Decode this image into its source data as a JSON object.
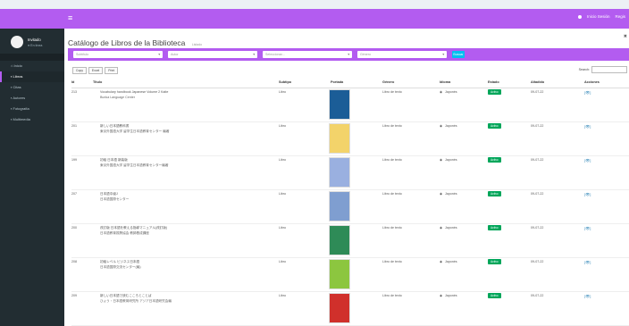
{
  "topbar": {
    "menu_icon": "hamburger-icon",
    "nav_items": [
      "Inicio Sesión",
      "Regis"
    ]
  },
  "sidebar": {
    "user_name": "Invitado",
    "user_status": "● En línea",
    "items": [
      {
        "label": "Inicio",
        "icon": "home-icon"
      },
      {
        "label": "Libros",
        "icon": "book-icon",
        "active": true
      },
      {
        "label": "Citas",
        "icon": "calendar-icon"
      },
      {
        "label": "Autores",
        "icon": "user-icon"
      },
      {
        "label": "Fotografía",
        "icon": "image-icon"
      },
      {
        "label": "Multimedia",
        "icon": "media-icon"
      }
    ]
  },
  "page": {
    "title": "Catálogo de Libros de la Biblioteca",
    "subtitle": "Listado"
  },
  "filters": {
    "fields": [
      {
        "placeholder": "Subtítulo"
      },
      {
        "placeholder": "Autor"
      },
      {
        "placeholder": "Seleccionar..."
      },
      {
        "placeholder": "Género"
      }
    ],
    "search_button": "Buscar"
  },
  "exports": [
    "Copy",
    "Excel",
    "Print"
  ],
  "search": {
    "label": "Search:"
  },
  "table": {
    "headers": [
      "Id",
      "Titulo",
      "Subtipo",
      "Portada",
      "Género",
      "Idioma",
      "Estado",
      "Añadido",
      "Acciones"
    ],
    "rows": [
      {
        "id": "213",
        "title": "Vocabulary handbook Japanese Volume 2 Kaite",
        "author": "Bunka Language Center",
        "subtype": "Libro",
        "genre": "Libro de texto",
        "language": "Japonés",
        "status": "Activo",
        "added": "09-07-22",
        "cover": "#1b5d97"
      },
      {
        "id": "201",
        "title": "新しい日本語教科書",
        "author": "東京外国語大学 留学生日本語教育センター 編著",
        "subtype": "Libro",
        "genre": "Libro de texto",
        "language": "Japonés",
        "status": "Activo",
        "added": "09-07-22",
        "cover": "#f3d36a"
      },
      {
        "id": "199",
        "title": "初級 日本語 新装版",
        "author": "東京外国語大学 留学生日本語教育センター編著",
        "subtype": "Libro",
        "genre": "Libro de texto",
        "language": "Japonés",
        "status": "Activo",
        "added": "09-07-22",
        "cover": "#9ab0e0"
      },
      {
        "id": "207",
        "title": "日本語中級J",
        "author": "日本語国際センター",
        "subtype": "Libro",
        "genre": "Libro de texto",
        "language": "Japonés",
        "status": "Activo",
        "added": "09-07-22",
        "cover": "#7f9ed0"
      },
      {
        "id": "200",
        "title": "改訂版 日本語を教える指導マニュアル(改訂版)",
        "author": "日本語教育振興協会 教師養成講座",
        "subtype": "Libro",
        "genre": "Libro de texto",
        "language": "Japonés",
        "status": "Activo",
        "added": "09-07-22",
        "cover": "#2e8b57"
      },
      {
        "id": "208",
        "title": "初級レベル ビジネス日本語",
        "author": "日本語国際交流センター(編)",
        "subtype": "Libro",
        "genre": "Libro de texto",
        "language": "Japonés",
        "status": "Activo",
        "added": "09-07-22",
        "cover": "#8cc63f"
      },
      {
        "id": "209",
        "title": "新しい日本語で読むこころとことば",
        "author": "ひょう・日本語教育研究所 アジア日本語研究会編",
        "subtype": "Libro",
        "genre": "Libro de texto",
        "language": "Japonés",
        "status": "Activo",
        "added": "09-07-22",
        "cover": "#d0302b"
      }
    ]
  },
  "actions": {
    "view_icon": "eye-icon"
  }
}
